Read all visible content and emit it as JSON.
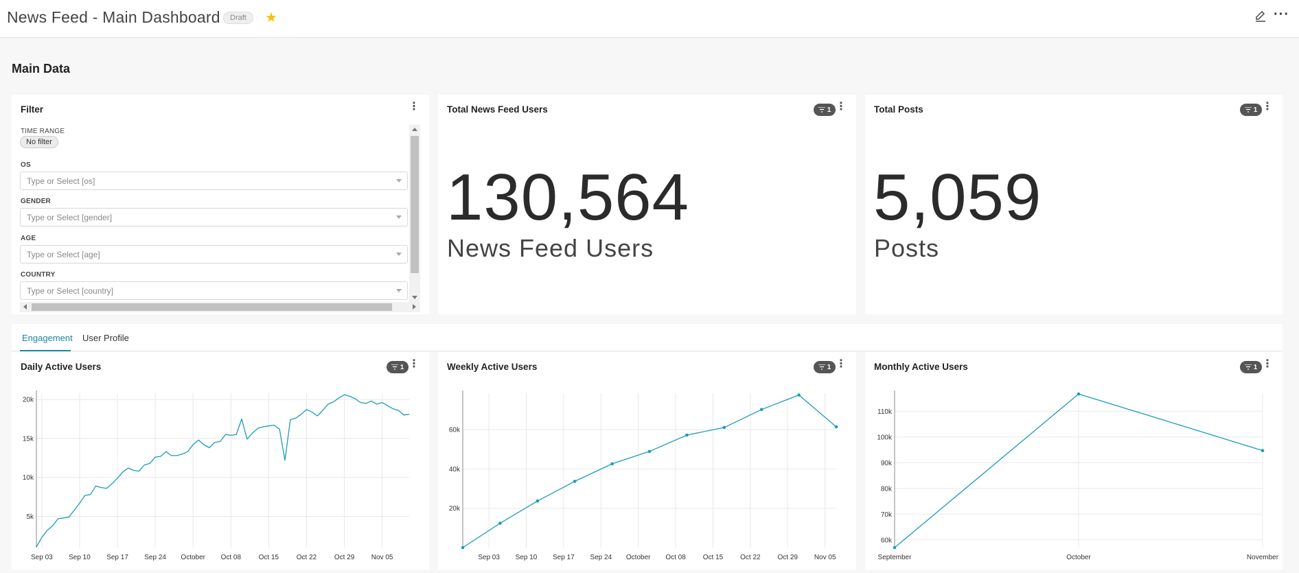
{
  "header": {
    "title": "News Feed - Main Dashboard",
    "badge": "Draft",
    "star_icon": "star-icon",
    "edit_icon": "pencil-icon",
    "more_icon": "more-horizontal-icon",
    "more_glyph": "···"
  },
  "section": {
    "title": "Main Data"
  },
  "filter_panel": {
    "title": "Filter",
    "time_range_label": "TIME RANGE",
    "time_range_value": "No filter",
    "os_label": "OS",
    "os_placeholder": "Type or Select [os]",
    "gender_label": "GENDER",
    "gender_placeholder": "Type or Select [gender]",
    "age_label": "AGE",
    "age_placeholder": "Type or Select [age]",
    "country_label": "COUNTRY",
    "country_placeholder": "Type or Select [country]"
  },
  "menu_glyph": "⋮",
  "badges": {
    "count": "1"
  },
  "kpi_users": {
    "title": "Total News Feed Users",
    "value": "130,564",
    "subheader": "News Feed Users"
  },
  "kpi_posts": {
    "title": "Total Posts",
    "value": "5,059",
    "subheader": "Posts"
  },
  "tabs": {
    "engagement": "Engagement",
    "user_profile": "User Profile"
  },
  "colors": {
    "accent": "#1a9bbd",
    "tab_active": "#1a85a0",
    "star": "#f4c20d"
  },
  "chart_data": [
    {
      "type": "line",
      "title": "Daily Active Users",
      "ylim": [
        1000,
        20800
      ],
      "yticks": [
        {
          "v": 5000,
          "l": "5k"
        },
        {
          "v": 10000,
          "l": "10k"
        },
        {
          "v": 15000,
          "l": "15k"
        },
        {
          "v": 20000,
          "l": "20k"
        }
      ],
      "xlim": [
        0,
        69
      ],
      "xticks": [
        {
          "v": 1,
          "l": "Sep 03"
        },
        {
          "v": 8,
          "l": "Sep 10"
        },
        {
          "v": 15,
          "l": "Sep 17"
        },
        {
          "v": 22,
          "l": "Sep 24"
        },
        {
          "v": 29,
          "l": "October"
        },
        {
          "v": 36,
          "l": "Oct 08"
        },
        {
          "v": 43,
          "l": "Oct 15"
        },
        {
          "v": 50,
          "l": "Oct 22"
        },
        {
          "v": 57,
          "l": "Oct 29"
        },
        {
          "v": 64,
          "l": "Nov 05"
        }
      ],
      "markers": false,
      "series": [
        {
          "x": [
            0,
            1,
            2,
            3,
            4,
            5,
            6,
            7,
            8,
            9,
            10,
            11,
            12,
            13,
            14,
            15,
            16,
            17,
            18,
            19,
            20,
            21,
            22,
            23,
            24,
            25,
            26,
            27,
            28,
            29,
            30,
            31,
            32,
            33,
            34,
            35,
            36,
            37,
            38,
            39,
            40,
            41,
            42,
            43,
            44,
            45,
            46,
            47,
            48,
            49,
            50,
            51,
            52,
            53,
            54,
            55,
            56,
            57,
            58,
            59,
            60,
            61,
            62,
            63,
            64,
            65,
            66,
            67,
            68,
            69
          ],
          "values": [
            1100,
            2300,
            3200,
            3800,
            4700,
            4800,
            4900,
            5800,
            6700,
            7700,
            7800,
            8900,
            8700,
            8600,
            9200,
            9900,
            10700,
            11200,
            10900,
            10800,
            11600,
            11800,
            12600,
            12700,
            13300,
            12800,
            12800,
            13000,
            13300,
            14200,
            14800,
            14200,
            13800,
            14500,
            14600,
            15500,
            15400,
            15500,
            17500,
            14900,
            15700,
            16300,
            16500,
            16600,
            16700,
            16200,
            12200,
            17400,
            17600,
            18100,
            18700,
            18400,
            17900,
            18600,
            19400,
            19700,
            20200,
            20600,
            20400,
            20100,
            19600,
            19500,
            19800,
            19400,
            19600,
            19200,
            18800,
            18600,
            18000,
            18100
          ]
        }
      ]
    },
    {
      "type": "line",
      "title": "Weekly Active Users",
      "ylim": [
        0,
        78500
      ],
      "yticks": [
        {
          "v": 20000,
          "l": "20k"
        },
        {
          "v": 40000,
          "l": "40k"
        },
        {
          "v": 60000,
          "l": "60k"
        }
      ],
      "xlim": [
        0,
        10
      ],
      "xticks": [
        {
          "v": 0.7,
          "l": "Sep 03"
        },
        {
          "v": 1.7,
          "l": "Sep 10"
        },
        {
          "v": 2.7,
          "l": "Sep 17"
        },
        {
          "v": 3.7,
          "l": "Sep 24"
        },
        {
          "v": 4.7,
          "l": "October"
        },
        {
          "v": 5.7,
          "l": "Oct 08"
        },
        {
          "v": 6.7,
          "l": "Oct 15"
        },
        {
          "v": 7.7,
          "l": "Oct 22"
        },
        {
          "v": 8.7,
          "l": "Oct 29"
        },
        {
          "v": 9.7,
          "l": "Nov 05"
        }
      ],
      "markers": true,
      "series": [
        {
          "x": [
            0,
            1,
            2,
            3,
            4,
            5,
            6,
            7,
            8,
            9,
            10
          ],
          "values": [
            0,
            12400,
            23700,
            33700,
            42600,
            48900,
            57200,
            61100,
            70200,
            77600,
            61400
          ]
        }
      ]
    },
    {
      "type": "line",
      "title": "Monthly Active Users",
      "ylim": [
        57000,
        117000
      ],
      "yticks": [
        {
          "v": 60000,
          "l": "60k"
        },
        {
          "v": 70000,
          "l": "70k"
        },
        {
          "v": 80000,
          "l": "80k"
        },
        {
          "v": 90000,
          "l": "90k"
        },
        {
          "v": 100000,
          "l": "100k"
        },
        {
          "v": 110000,
          "l": "110k"
        }
      ],
      "xlim": [
        0,
        2
      ],
      "xticks": [
        {
          "v": 0,
          "l": "September"
        },
        {
          "v": 1,
          "l": "October"
        },
        {
          "v": 2,
          "l": "November"
        }
      ],
      "markers": true,
      "series": [
        {
          "x": [
            0,
            1,
            2
          ],
          "values": [
            57000,
            116700,
            94700
          ]
        }
      ]
    }
  ]
}
